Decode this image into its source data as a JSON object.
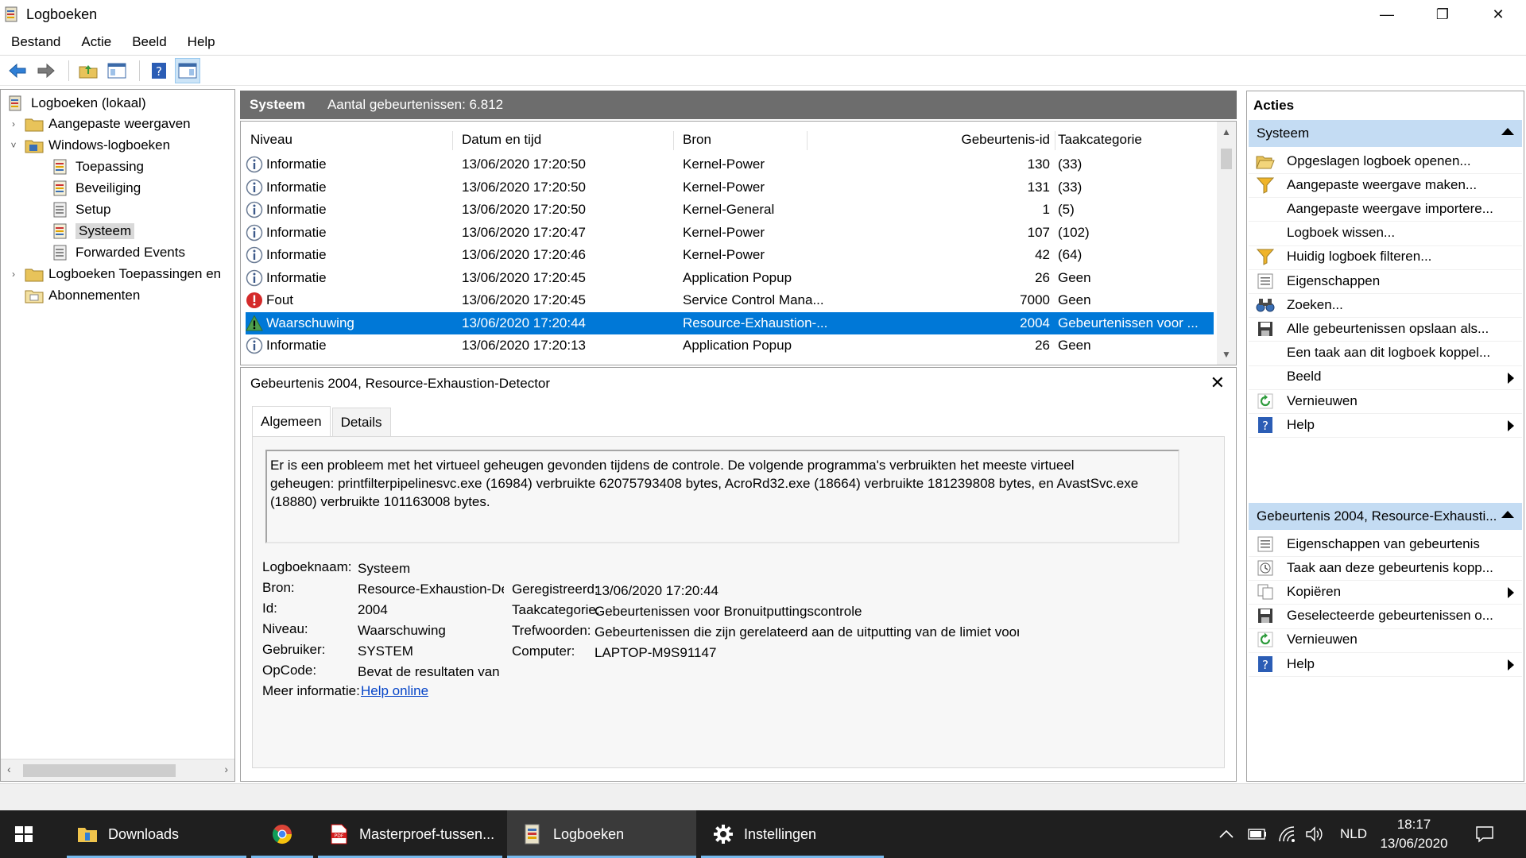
{
  "window": {
    "title": "Logboeken",
    "minimize": "—",
    "restore": "❐",
    "close": "✕"
  },
  "menu": [
    "Bestand",
    "Actie",
    "Beeld",
    "Help"
  ],
  "tree": [
    {
      "label": "Logboeken (lokaal)",
      "twisty": ""
    },
    {
      "label": "Aangepaste weergaven",
      "twisty": "›"
    },
    {
      "label": "Windows-logboeken",
      "twisty": "˅"
    },
    {
      "label": "Toepassing",
      "twisty": ""
    },
    {
      "label": "Beveiliging",
      "twisty": ""
    },
    {
      "label": "Setup",
      "twisty": ""
    },
    {
      "label": "Systeem",
      "twisty": "",
      "selected": true
    },
    {
      "label": "Forwarded Events",
      "twisty": ""
    },
    {
      "label": "Logboeken Toepassingen en",
      "twisty": "›"
    },
    {
      "label": "Abonnementen",
      "twisty": ""
    }
  ],
  "log_header": {
    "name": "Systeem",
    "count": "Aantal gebeurtenissen: 6.812"
  },
  "columns": [
    "Niveau",
    "Datum en tijd",
    "Bron",
    "Gebeurtenis-id",
    "Taakcategorie"
  ],
  "events": [
    {
      "level": "Informatie",
      "icon": "info-icon",
      "date": "13/06/2020 17:20:50",
      "source": "Kernel-Power",
      "id": "130",
      "category": "(33)"
    },
    {
      "level": "Informatie",
      "icon": "info-icon",
      "date": "13/06/2020 17:20:50",
      "source": "Kernel-Power",
      "id": "131",
      "category": "(33)"
    },
    {
      "level": "Informatie",
      "icon": "info-icon",
      "date": "13/06/2020 17:20:50",
      "source": "Kernel-General",
      "id": "1",
      "category": "(5)"
    },
    {
      "level": "Informatie",
      "icon": "info-icon",
      "date": "13/06/2020 17:20:47",
      "source": "Kernel-Power",
      "id": "107",
      "category": "(102)"
    },
    {
      "level": "Informatie",
      "icon": "info-icon",
      "date": "13/06/2020 17:20:46",
      "source": "Kernel-Power",
      "id": "42",
      "category": "(64)"
    },
    {
      "level": "Informatie",
      "icon": "info-icon",
      "date": "13/06/2020 17:20:45",
      "source": "Application Popup",
      "id": "26",
      "category": "Geen"
    },
    {
      "level": "Fout",
      "icon": "error-icon",
      "date": "13/06/2020 17:20:45",
      "source": "Service Control Mana...",
      "id": "7000",
      "category": "Geen"
    },
    {
      "level": "Waarschuwing",
      "icon": "warning-icon",
      "date": "13/06/2020 17:20:44",
      "source": "Resource-Exhaustion-...",
      "id": "2004",
      "category": "Gebeurtenissen voor ...",
      "selected": true
    },
    {
      "level": "Informatie",
      "icon": "info-icon",
      "date": "13/06/2020 17:20:13",
      "source": "Application Popup",
      "id": "26",
      "category": "Geen"
    }
  ],
  "detail": {
    "title": "Gebeurtenis 2004, Resource-Exhaustion-Detector",
    "close": "✕",
    "tabs": [
      "Algemeen",
      "Details"
    ],
    "message_lines": [
      "Er is een probleem met het virtueel geheugen gevonden tijdens de controle. De volgende programma's verbruikten het meeste virtueel",
      "geheugen: printfilterpipelinesvc.exe (16984) verbruikte 62075793408 bytes, AcroRd32.exe (18664) verbruikte 181239808 bytes, en AvastSvc.exe",
      "(18880) verbruikte 101163008 bytes."
    ],
    "labels": {
      "logname": "Logboeknaam:",
      "source": "Bron:",
      "id": "Id:",
      "level": "Niveau:",
      "user": "Gebruiker:",
      "opcode": "OpCode:",
      "moreinfo": "Meer informatie:",
      "logged": "Geregistreerd:",
      "category": "Taakcategorie:",
      "keywords": "Trefwoorden:",
      "computer": "Computer:"
    },
    "values": {
      "logname": "Systeem",
      "source": "Resource-Exhaustion-Detector",
      "id": "2004",
      "level": "Waarschuwing",
      "user": "SYSTEM",
      "opcode": "Bevat de resultaten van de controle",
      "moreinfo": "Help online",
      "logged": "13/06/2020 17:20:44",
      "category": "Gebeurtenissen voor Bronuitputtingscontrole",
      "keywords": "Gebeurtenissen die zijn gerelateerd aan de uitputting van de limiet voor systeemtoewijzing",
      "computer": "LAPTOP-M9S91147"
    }
  },
  "actions": {
    "title": "Acties",
    "section1": "Systeem",
    "items1": [
      {
        "label": "Opgeslagen logboek openen...",
        "icon": "folder-open-icon",
        "submenu": false
      },
      {
        "label": "Aangepaste weergave maken...",
        "icon": "filter-icon",
        "submenu": false
      },
      {
        "label": "Aangepaste weergave importere...",
        "icon": "",
        "submenu": false
      },
      {
        "label": "Logboek wissen...",
        "icon": "",
        "submenu": false
      },
      {
        "label": "Huidig logboek filteren...",
        "icon": "filter-icon",
        "submenu": false
      },
      {
        "label": "Eigenschappen",
        "icon": "properties-icon",
        "submenu": false
      },
      {
        "label": "Zoeken...",
        "icon": "binoculars-icon",
        "submenu": false
      },
      {
        "label": "Alle gebeurtenissen opslaan als...",
        "icon": "save-icon",
        "submenu": false
      },
      {
        "label": "Een taak aan dit logboek koppel...",
        "icon": "",
        "submenu": false
      },
      {
        "label": "Beeld",
        "icon": "",
        "submenu": true
      },
      {
        "label": "Vernieuwen",
        "icon": "refresh-icon",
        "submenu": false
      },
      {
        "label": "Help",
        "icon": "help-icon",
        "submenu": true
      }
    ],
    "section2": "Gebeurtenis 2004, Resource-Exhausti...",
    "items2": [
      {
        "label": "Eigenschappen van gebeurtenis",
        "icon": "properties-icon",
        "submenu": false
      },
      {
        "label": "Taak aan deze gebeurtenis kopp...",
        "icon": "task-icon",
        "submenu": false
      },
      {
        "label": "Kopiëren",
        "icon": "copy-icon",
        "submenu": true
      },
      {
        "label": "Geselecteerde gebeurtenissen o...",
        "icon": "save-icon",
        "submenu": false
      },
      {
        "label": "Vernieuwen",
        "icon": "refresh-icon",
        "submenu": false
      },
      {
        "label": "Help",
        "icon": "help-icon",
        "submenu": true
      }
    ]
  },
  "taskbar": {
    "items": [
      {
        "label": "Downloads",
        "icon": "folder-icon"
      },
      {
        "label": "",
        "icon": "chrome-icon"
      },
      {
        "label": "Masterproef-tussen...",
        "icon": "pdf-icon"
      },
      {
        "label": "Logboeken",
        "icon": "event-viewer-icon",
        "active": true
      },
      {
        "label": "Instellingen",
        "icon": "gear-icon"
      }
    ],
    "language": "NLD",
    "time": "18:17",
    "date": "13/06/2020"
  }
}
